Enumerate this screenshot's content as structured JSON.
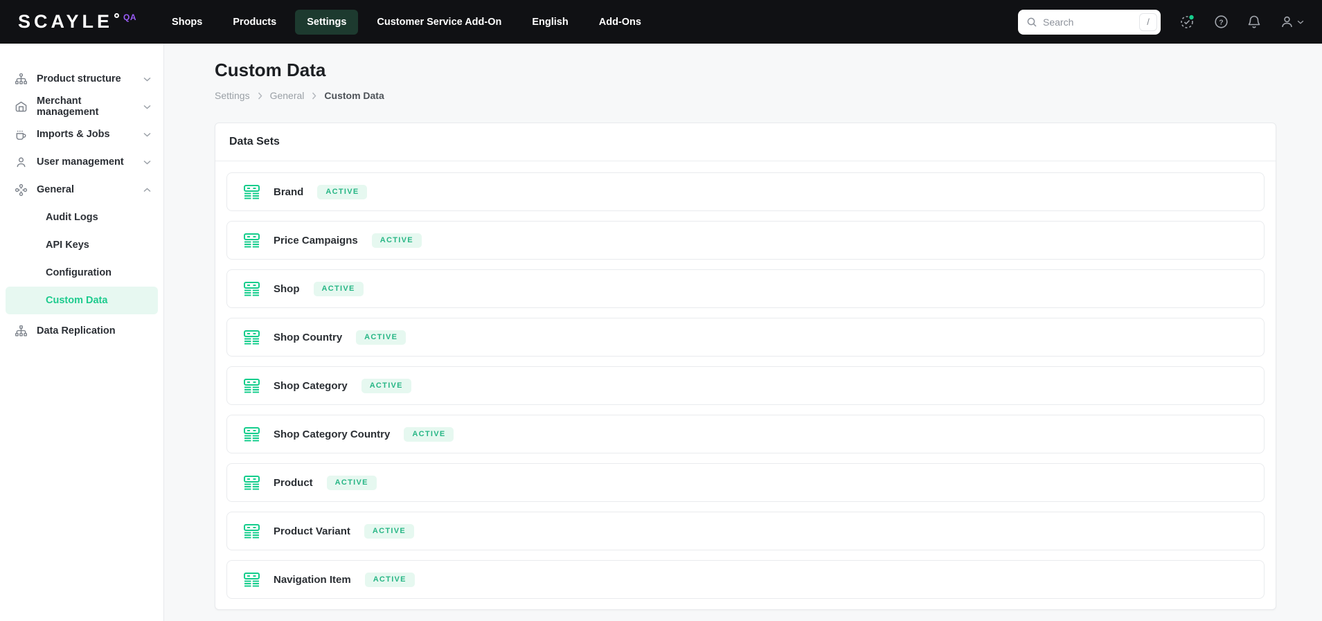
{
  "colors": {
    "brand_green": "#17cd8c",
    "badge_bg": "#e6f8f0",
    "badge_text": "#27b685",
    "active_nav_bg": "#1d3a2f",
    "sidebar_active_bg": "#e7f8f1",
    "sidebar_active_text": "#1ecb8e",
    "qa_purple": "#9a5cf7",
    "navbar_bg": "#101114"
  },
  "navbar": {
    "logo_text": "SCAYLE",
    "logo_env": "QA",
    "items": [
      {
        "label": "Shops"
      },
      {
        "label": "Products"
      },
      {
        "label": "Settings",
        "active": true
      },
      {
        "label": "Customer Service Add-On"
      },
      {
        "label": "English"
      },
      {
        "label": "Add-Ons"
      }
    ],
    "search": {
      "placeholder": "Search",
      "shortcut": "/"
    },
    "icons": [
      "release-status-icon",
      "help-icon",
      "notifications-icon",
      "account-icon"
    ]
  },
  "sidebar": {
    "items": [
      {
        "label": "Product structure",
        "icon": "sitemap",
        "chevron": "down"
      },
      {
        "label": "Merchant management",
        "icon": "store",
        "chevron": "down"
      },
      {
        "label": "Imports & Jobs",
        "icon": "mug",
        "chevron": "down"
      },
      {
        "label": "User management",
        "icon": "user",
        "chevron": "down"
      },
      {
        "label": "General",
        "icon": "nodes",
        "chevron": "up",
        "expanded": true
      },
      {
        "label": "Data Replication",
        "icon": "sitemap"
      }
    ],
    "general_children": [
      {
        "label": "Audit Logs"
      },
      {
        "label": "API Keys"
      },
      {
        "label": "Configuration"
      },
      {
        "label": "Custom Data",
        "active": true
      }
    ]
  },
  "page": {
    "title": "Custom Data",
    "breadcrumb": {
      "items": [
        "Settings",
        "General",
        "Custom Data"
      ]
    },
    "card": {
      "header": "Data Sets",
      "rows": [
        {
          "label": "Brand",
          "status": "ACTIVE"
        },
        {
          "label": "Price Campaigns",
          "status": "ACTIVE"
        },
        {
          "label": "Shop",
          "status": "ACTIVE"
        },
        {
          "label": "Shop Country",
          "status": "ACTIVE"
        },
        {
          "label": "Shop Category",
          "status": "ACTIVE"
        },
        {
          "label": "Shop Category Country",
          "status": "ACTIVE"
        },
        {
          "label": "Product",
          "status": "ACTIVE"
        },
        {
          "label": "Product Variant",
          "status": "ACTIVE"
        },
        {
          "label": "Navigation Item",
          "status": "ACTIVE"
        }
      ]
    }
  }
}
